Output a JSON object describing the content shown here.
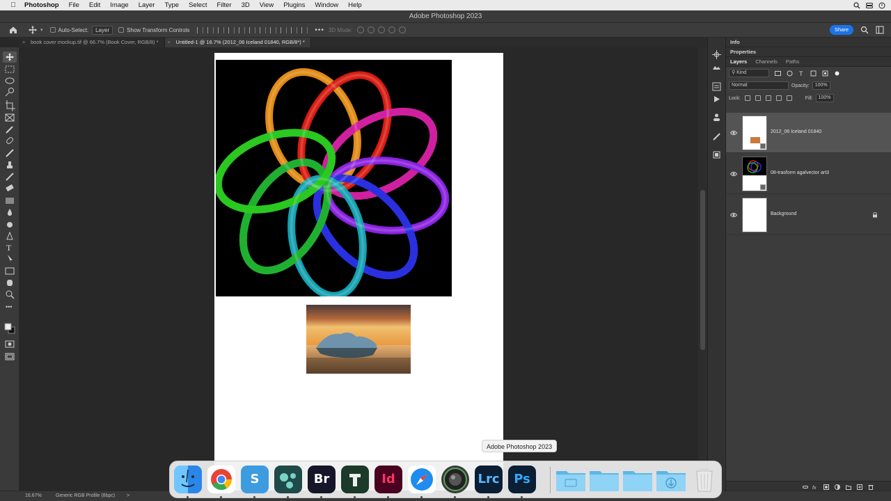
{
  "menubar": {
    "app": "Photoshop",
    "items": [
      "File",
      "Edit",
      "Image",
      "Layer",
      "Type",
      "Select",
      "Filter",
      "3D",
      "View",
      "Plugins",
      "Window",
      "Help"
    ]
  },
  "window": {
    "title": "Adobe Photoshop 2023"
  },
  "options": {
    "auto_select_label": "Auto-Select:",
    "auto_select_value": "Layer",
    "transform_label": "Show Transform Controls",
    "mode_3d": "3D Mode:",
    "share_label": "Share"
  },
  "tabs": [
    {
      "label": "book cover mockup.tif @ 66.7% (Book Cover, RGB/8) *",
      "active": false
    },
    {
      "label": "Untitled-1 @ 16.7% (2012_06 Iceland 01840, RGB/8*) *",
      "active": true
    }
  ],
  "panels": {
    "info": "Info",
    "properties": "Properties",
    "tabs": [
      "Layers",
      "Channels",
      "Paths"
    ],
    "filter_kind": "Kind",
    "blend_mode": "Normal",
    "opacity_label": "Opacity:",
    "opacity_value": "100%",
    "lock_label": "Lock:",
    "fill_label": "Fill:",
    "fill_value": "100%"
  },
  "layers": [
    {
      "name": "2012_06 Iceland 01840",
      "selected": true
    },
    {
      "name": "08-trasform agalvector art3",
      "selected": false
    },
    {
      "name": "Background",
      "selected": false,
      "locked": true
    }
  ],
  "status": {
    "zoom": "16.67%",
    "profile": "Generic RGB Profile (8bpc)",
    "arrow": ">"
  },
  "dock": {
    "tooltip": "Adobe Photoshop 2023",
    "apps": [
      {
        "name": "Finder",
        "text": "",
        "color": "#3d8ef0"
      },
      {
        "name": "Chrome",
        "text": "",
        "color": "#ffffff"
      },
      {
        "name": "Scrivener",
        "text": "S",
        "color": "#3d9be0"
      },
      {
        "name": "Mindnode",
        "text": "",
        "color": "#1f4a4a"
      },
      {
        "name": "Bridge",
        "text": "Br",
        "color": "#16162a"
      },
      {
        "name": "Typeface",
        "text": "",
        "color": "#1b3a2a"
      },
      {
        "name": "InDesign",
        "text": "Id",
        "color": "#49021f"
      },
      {
        "name": "Safari",
        "text": "",
        "color": "#1e8cf0"
      },
      {
        "name": "Lens",
        "text": "",
        "color": "#3a3a3a"
      },
      {
        "name": "Lightroom Classic",
        "text": "Lrc",
        "color": "#0b1e33"
      },
      {
        "name": "Photoshop",
        "text": "Ps",
        "color": "#0b1e33"
      }
    ],
    "folders": [
      "Applications",
      "Documents",
      "Desktop",
      "Downloads"
    ],
    "colors": {
      "lrc_text": "#59b8ff",
      "ps_text": "#31a8ff",
      "id_text": "#ff3366",
      "folder": "#8fd3f7"
    }
  }
}
